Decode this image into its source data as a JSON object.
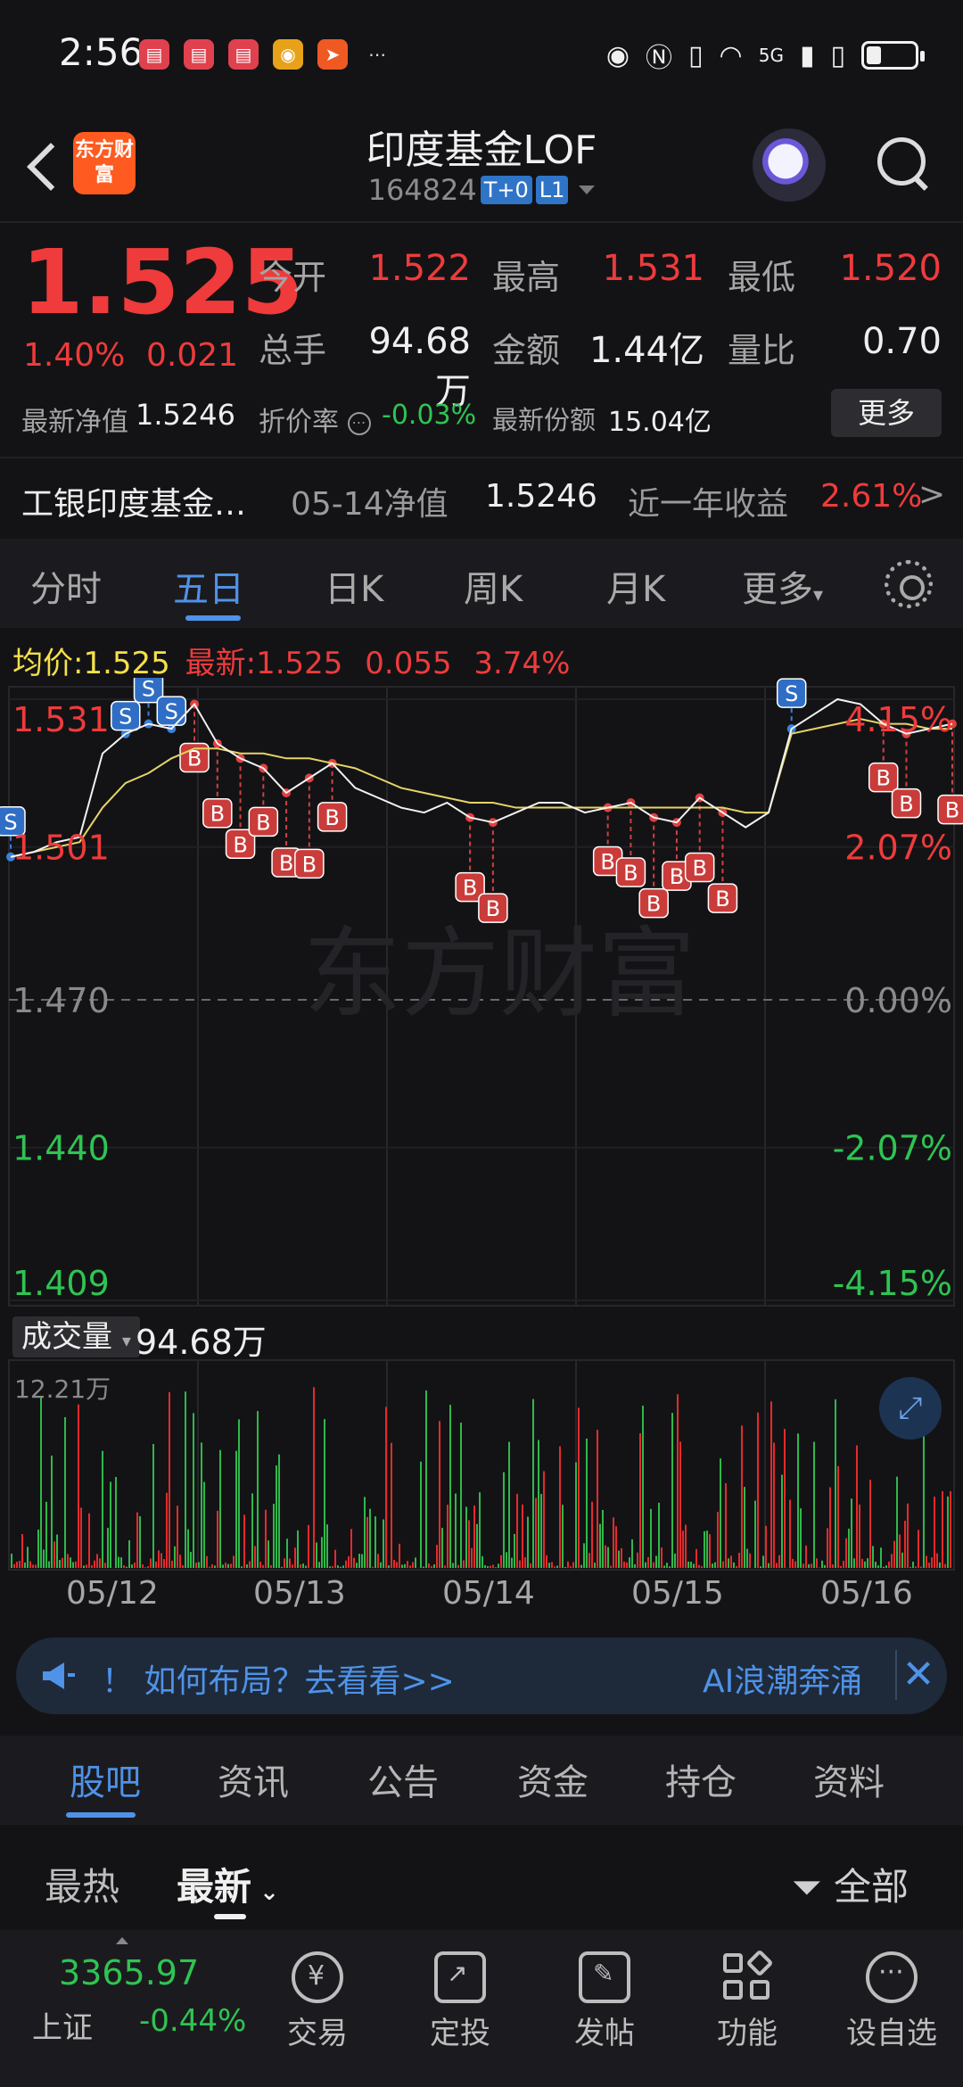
{
  "status": {
    "time": "2:56",
    "network": "5G"
  },
  "header": {
    "brand": "东方财富",
    "title": "印度基金LOF",
    "code": "164824",
    "tag1": "T+0",
    "tag2": "L1"
  },
  "quote": {
    "price": "1.525",
    "pct": "1.40%",
    "chg": "0.021",
    "open_lbl": "今开",
    "open": "1.522",
    "high_lbl": "最高",
    "high": "1.531",
    "low_lbl": "最低",
    "low": "1.520",
    "vol_lbl": "总手",
    "vol": "94.68万",
    "amt_lbl": "金额",
    "amt": "1.44亿",
    "ratio_lbl": "量比",
    "ratio": "0.70",
    "nav_lbl": "最新净值",
    "nav": "1.5246",
    "discount_lbl": "折价率",
    "discount": "-0.03%",
    "share_lbl": "最新份额",
    "share": "15.04亿",
    "more": "更多"
  },
  "fund": {
    "name": "工银印度基金…",
    "nav_date_lbl": "05-14净值",
    "nav": "1.5246",
    "yr_lbl": "近一年收益",
    "yr": "2.61%",
    "arrow": ">"
  },
  "tabs": [
    "分时",
    "五日",
    "日K",
    "周K",
    "月K",
    "更多"
  ],
  "avg": {
    "avg_lbl": "均价:",
    "avg": "1.525",
    "last_lbl": "最新:",
    "last": "1.525",
    "chg": "0.055",
    "pct": "3.74%"
  },
  "chart_data": {
    "type": "line",
    "title": "",
    "x_dates": [
      "05/12",
      "05/13",
      "05/14",
      "05/15",
      "05/16"
    ],
    "y_left_ticks": [
      "1.531",
      "1.501",
      "1.470",
      "1.440",
      "1.409"
    ],
    "y_right_ticks": [
      "4.15%",
      "2.07%",
      "0.00%",
      "-2.07%",
      "-4.15%"
    ],
    "ylim": [
      1.409,
      1.531
    ],
    "series": [
      {
        "name": "价格",
        "values": [
          1.499,
          1.5,
          1.502,
          1.503,
          1.52,
          1.524,
          1.526,
          1.525,
          1.53,
          1.522,
          1.519,
          1.517,
          1.512,
          1.515,
          1.518,
          1.513,
          1.511,
          1.509,
          1.508,
          1.51,
          1.507,
          1.506,
          1.508,
          1.51,
          1.51,
          1.508,
          1.509,
          1.51,
          1.507,
          1.506,
          1.511,
          1.508,
          1.505,
          1.508,
          1.525,
          1.528,
          1.531,
          1.53,
          1.526,
          1.524,
          1.525,
          1.526
        ]
      },
      {
        "name": "均价",
        "values": [
          1.499,
          1.5,
          1.501,
          1.502,
          1.509,
          1.514,
          1.516,
          1.519,
          1.521,
          1.521,
          1.52,
          1.52,
          1.519,
          1.519,
          1.518,
          1.517,
          1.515,
          1.513,
          1.512,
          1.511,
          1.51,
          1.51,
          1.509,
          1.509,
          1.509,
          1.509,
          1.509,
          1.509,
          1.509,
          1.509,
          1.509,
          1.509,
          1.508,
          1.508,
          1.524,
          1.525,
          1.526,
          1.527,
          1.526,
          1.526,
          1.525,
          1.525
        ]
      }
    ],
    "volume": {
      "label": "成交量",
      "total": "94.68万",
      "max": "12.21万"
    },
    "watermark": "东方财富"
  },
  "banner": {
    "text": "！ 如何布局？去看看>>",
    "text2": "AI浪潮奔涌"
  },
  "section_tabs": [
    "股吧",
    "资讯",
    "公告",
    "资金",
    "持仓",
    "资料"
  ],
  "sort": {
    "hot": "最热",
    "new": "最新",
    "filter": "全部"
  },
  "bottom": {
    "index_price": "3365.97",
    "index_name": "上证",
    "index_chg": "-0.44%",
    "items": [
      "交易",
      "定投",
      "发帖",
      "功能",
      "设自选"
    ]
  }
}
